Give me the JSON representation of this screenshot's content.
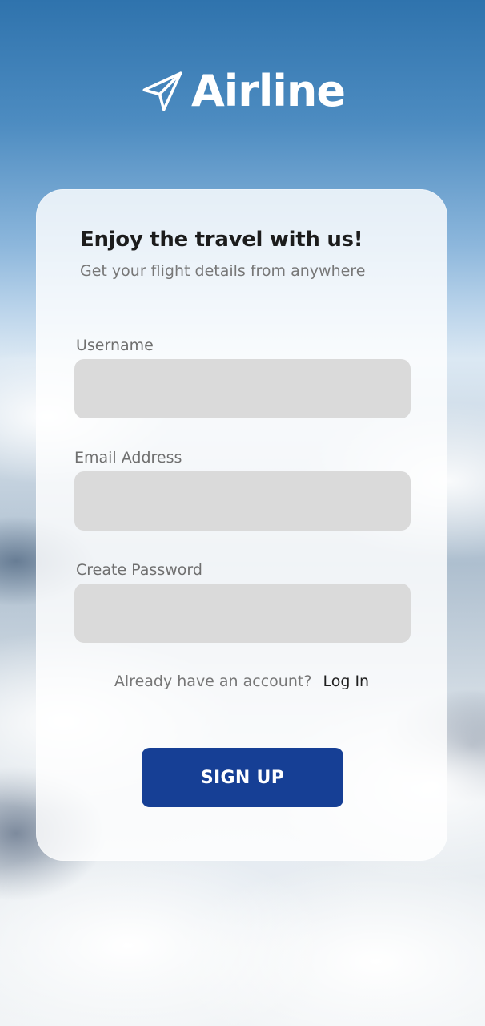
{
  "app": {
    "logo_text": "Airline",
    "logo_icon": "paper-plane-icon"
  },
  "signup_card": {
    "headline": "Enjoy the travel with us!",
    "subtitle": "Get your flight details from anywhere",
    "fields": {
      "username": {
        "label": "Username",
        "value": "",
        "placeholder": ""
      },
      "email": {
        "label": "Email Address",
        "value": "",
        "placeholder": ""
      },
      "password": {
        "label": "Create Password",
        "value": "",
        "placeholder": ""
      }
    },
    "account_prompt": "Already have an account?",
    "login_link": "Log In",
    "submit_button": "SIGN UP"
  },
  "colors": {
    "button_background": "#163f95",
    "input_background": "#dadada",
    "card_background": "#ffffff",
    "logo_color": "#ffffff"
  }
}
